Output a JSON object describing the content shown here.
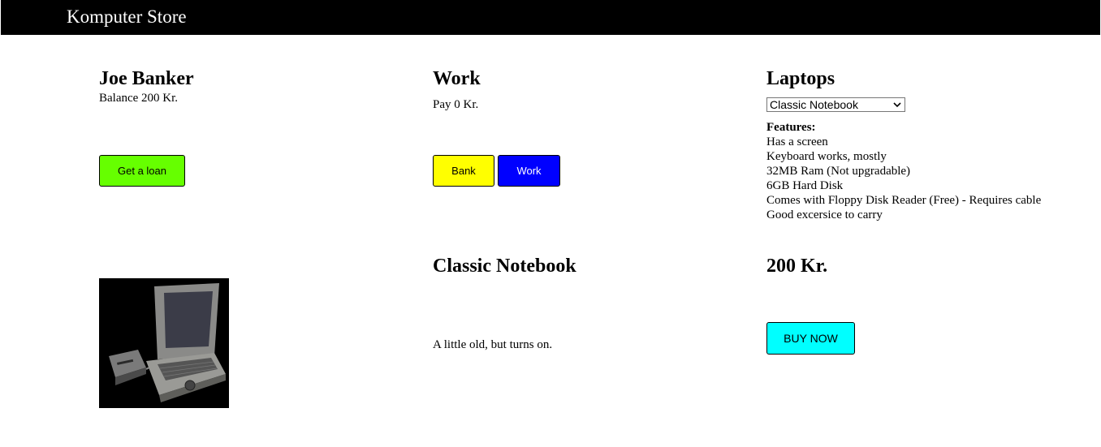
{
  "navbar": {
    "title": "Komputer Store"
  },
  "bank": {
    "name": "Joe Banker",
    "balance": "Balance 200 Kr.",
    "loan_button": "Get a loan"
  },
  "work": {
    "heading": "Work",
    "pay": "Pay 0 Kr.",
    "bank_button": "Bank",
    "work_button": "Work"
  },
  "laptops": {
    "heading": "Laptops",
    "selected": "Classic Notebook",
    "features_label": "Features:",
    "features": [
      "Has a screen",
      "Keyboard works, mostly",
      "32MB Ram (Not upgradable)",
      "6GB Hard Disk",
      "Comes with Floppy Disk Reader (Free) - Requires cable",
      "Good excersice to carry"
    ]
  },
  "product": {
    "name": "Classic Notebook",
    "description": "A little old, but turns on.",
    "price": "200 Kr.",
    "buy_button": "BUY NOW"
  },
  "colors": {
    "loan": "#66ff00",
    "bank": "#ffff00",
    "work": "#0000ff",
    "buy": "#00ffff"
  }
}
